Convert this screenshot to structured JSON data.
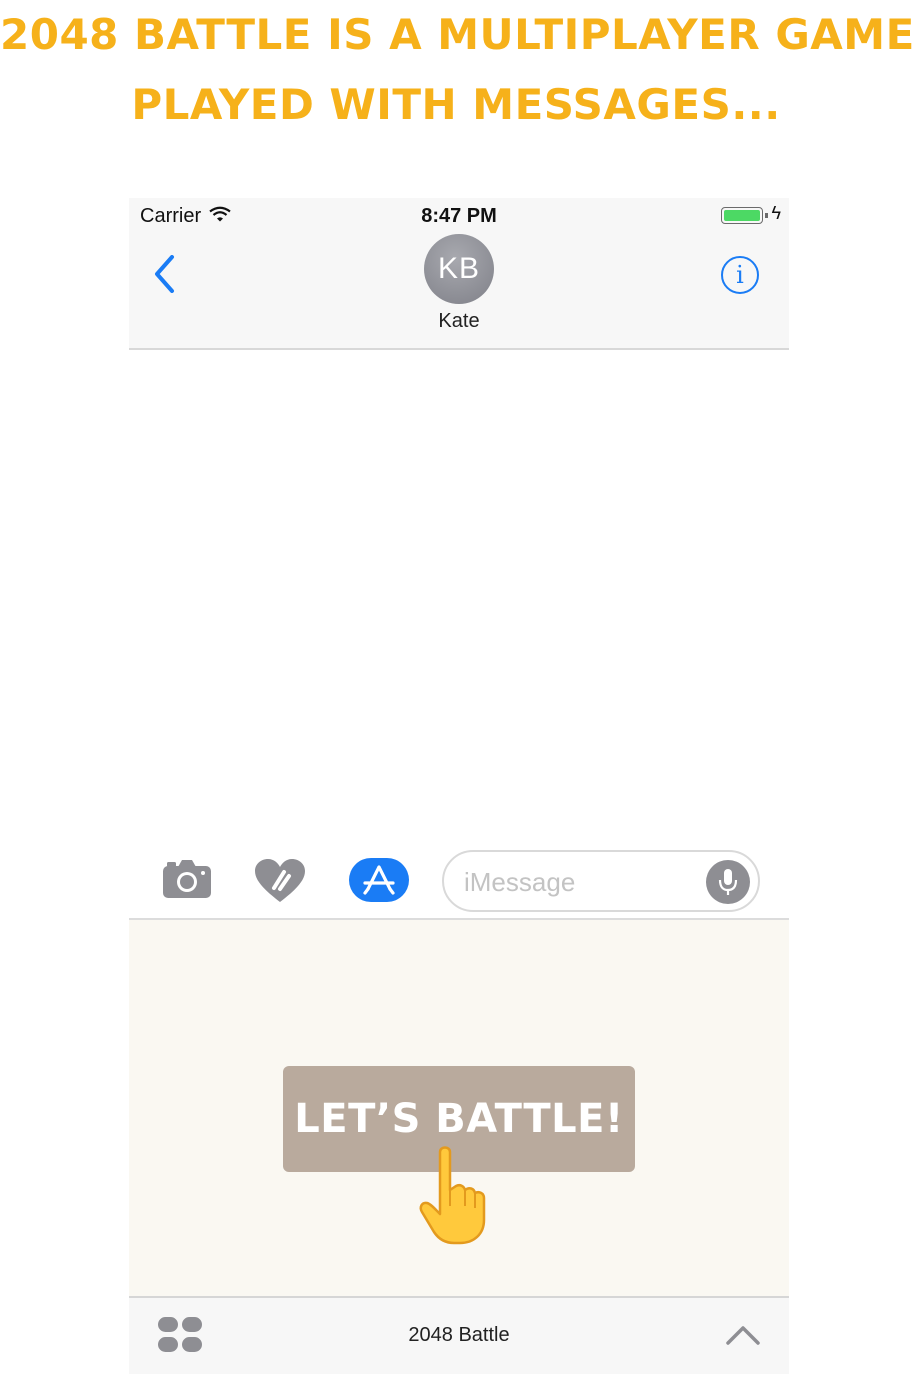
{
  "headline": {
    "line1": "2048 BATTLE IS A MULTIPLAYER GAME",
    "line2": "PLAYED WITH MESSAGES..."
  },
  "status_bar": {
    "carrier": "Carrier",
    "time": "8:47 PM",
    "battery_level": 1.0,
    "charging": true
  },
  "conversation": {
    "avatar_initials": "KB",
    "contact_name": "Kate"
  },
  "input_bar": {
    "message_placeholder": "iMessage",
    "message_value": ""
  },
  "game": {
    "battle_button_label": "LET’S BATTLE!"
  },
  "app_drawer": {
    "title": "2048 Battle"
  },
  "colors": {
    "headline": "#f6b11a",
    "ios_blue": "#1a7cf5",
    "battle_button": "#b9aa9d",
    "game_background": "#faf8f2",
    "battery_fill": "#4cd964"
  },
  "icons": {
    "carrier_signal": "wifi-icon",
    "back": "chevron-left-icon",
    "info": "info-icon",
    "camera": "camera-icon",
    "digital_touch": "heart-icon",
    "app_store": "app-store-icon",
    "dictation": "microphone-icon",
    "pointer": "pointing-hand-icon",
    "app_drawer": "app-drawer-icon",
    "expand": "chevron-up-icon"
  }
}
